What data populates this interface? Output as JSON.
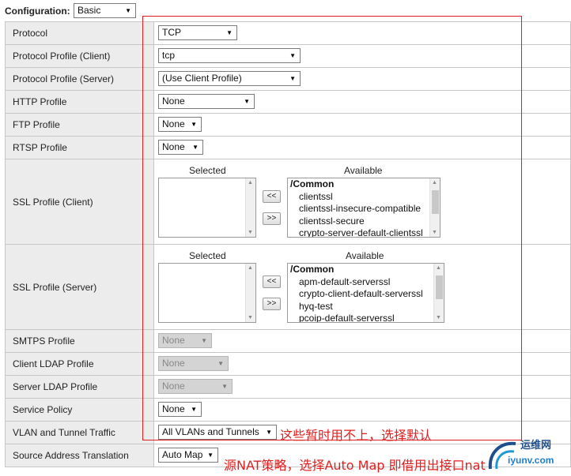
{
  "header": {
    "label": "Configuration:",
    "mode": "Basic"
  },
  "rows": {
    "protocol": {
      "label": "Protocol",
      "value": "TCP"
    },
    "protocol_profile_client": {
      "label": "Protocol Profile (Client)",
      "value": "tcp"
    },
    "protocol_profile_server": {
      "label": "Protocol Profile (Server)",
      "value": "(Use Client Profile)"
    },
    "http_profile": {
      "label": "HTTP Profile",
      "value": "None"
    },
    "ftp_profile": {
      "label": "FTP Profile",
      "value": "None"
    },
    "rtsp_profile": {
      "label": "RTSP Profile",
      "value": "None"
    },
    "ssl_client": {
      "label": "SSL Profile (Client)",
      "selected_heading": "Selected",
      "available_heading": "Available",
      "group": "/Common",
      "available": [
        "clientssl",
        "clientssl-insecure-compatible",
        "clientssl-secure",
        "crypto-server-default-clientssl"
      ],
      "add_label": "<<",
      "remove_label": ">>"
    },
    "ssl_server": {
      "label": "SSL Profile (Server)",
      "selected_heading": "Selected",
      "available_heading": "Available",
      "group": "/Common",
      "available": [
        "apm-default-serverssl",
        "crypto-client-default-serverssl",
        "hyq-test",
        "pcoip-default-serverssl"
      ],
      "add_label": "<<",
      "remove_label": ">>"
    },
    "smtps_profile": {
      "label": "SMTPS Profile",
      "value": "None"
    },
    "client_ldap_profile": {
      "label": "Client LDAP Profile",
      "value": "None"
    },
    "server_ldap_profile": {
      "label": "Server LDAP Profile",
      "value": "None"
    },
    "service_policy": {
      "label": "Service Policy",
      "value": "None"
    },
    "vlan_traffic": {
      "label": "VLAN and Tunnel Traffic",
      "value": "All VLANs and Tunnels"
    },
    "snat": {
      "label": "Source Address Translation",
      "value": "Auto Map"
    }
  },
  "annotations": {
    "note1": "这些暂时用不上，选择默认",
    "note2": "源NAT策略，选择Auto Map 即借用出接口nat"
  },
  "watermark": {
    "site_cn": "运维网",
    "url": "iyunv.com"
  },
  "colors": {
    "annotation": "#e01e1e",
    "label_bg": "#ececec",
    "disabled_bg": "#d4d4d4"
  }
}
